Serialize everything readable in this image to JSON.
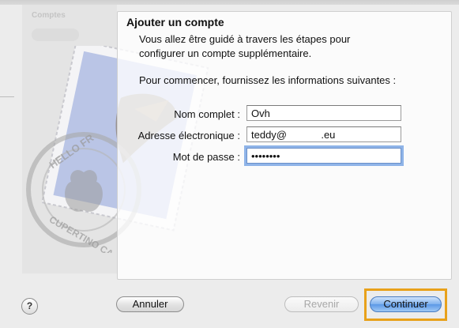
{
  "sheet": {
    "title": "Ajouter un compte",
    "intro": "Vous allez être guidé à travers les étapes pour configurer un compte supplémentaire.",
    "instruction": "Pour commencer, fournissez les informations suivantes :"
  },
  "form": {
    "name_label": "Nom complet :",
    "name_value": "Ovh",
    "email_label": "Adresse électronique :",
    "email_value": "teddy@            .eu",
    "password_label": "Mot de passe :",
    "password_value": "••••••••"
  },
  "buttons": {
    "help": "?",
    "cancel": "Annuler",
    "back": "Revenir",
    "continue": "Continuer"
  },
  "background": {
    "sidebar_label": "Comptes",
    "postmark_text": "HELLO FROM CUPERTINO CA"
  }
}
